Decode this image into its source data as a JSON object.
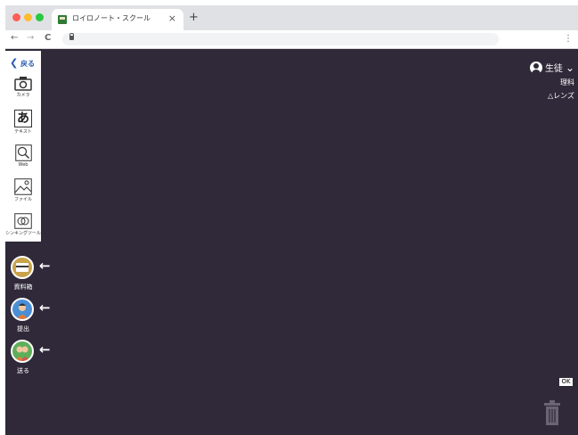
{
  "browser": {
    "tab_title": "ロイロノート・スクール",
    "tab_close": "×",
    "new_tab": "+",
    "back": "←",
    "forward": "→",
    "reload": "C",
    "menu": "⋮"
  },
  "toolbox": {
    "back_label": "戻る",
    "tools": [
      {
        "label": "カメラ",
        "icon": "camera-icon"
      },
      {
        "label": "テキスト",
        "icon": "text-a-icon",
        "glyph": "あ"
      },
      {
        "label": "Web",
        "icon": "web-search-icon"
      },
      {
        "label": "ファイル",
        "icon": "image-file-icon"
      },
      {
        "label": "シンキングツール",
        "icon": "thinking-tool-icon"
      }
    ]
  },
  "side_buttons": [
    {
      "label": "資料箱",
      "icon": "document-box-icon"
    },
    {
      "label": "提出",
      "icon": "submit-person-icon"
    },
    {
      "label": "送る",
      "icon": "send-people-icon"
    }
  ],
  "arrow_glyph": "←",
  "user": {
    "role": "生徒",
    "chevron": "⌄",
    "subject": "理科",
    "lens": "レンズ"
  },
  "ok_label": "OK",
  "colors": {
    "background": "#2f2939",
    "accent": "#2a5db0",
    "box_gold": "#c9a24a"
  }
}
